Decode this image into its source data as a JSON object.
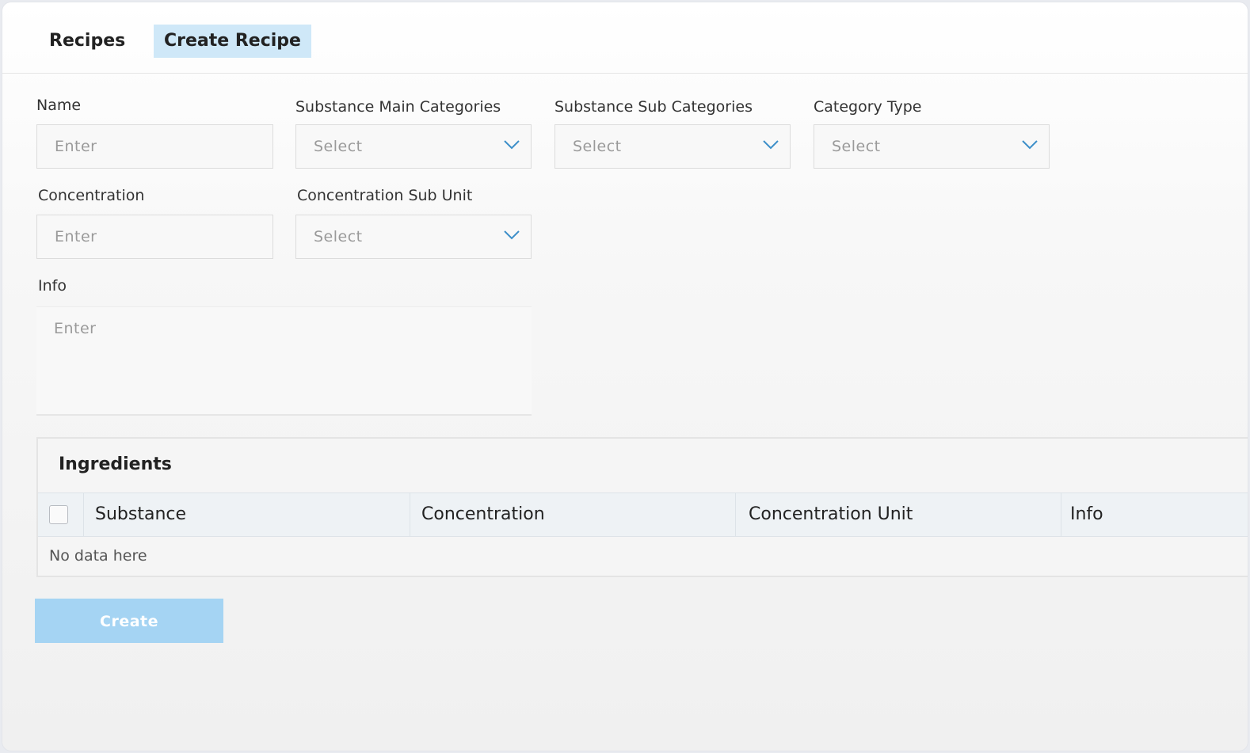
{
  "tabs": [
    {
      "label": "Recipes"
    },
    {
      "label": "Create Recipe"
    }
  ],
  "form": {
    "name": {
      "label": "Name",
      "placeholder": "Enter"
    },
    "main_categories": {
      "label": "Substance Main Categories",
      "value": "Select"
    },
    "sub_categories": {
      "label": "Substance Sub Categories",
      "value": "Select"
    },
    "category_type": {
      "label": "Category Type",
      "value": "Select"
    },
    "concentration": {
      "label": "Concentration",
      "placeholder": "Enter"
    },
    "concentration_sub_unit": {
      "label": "Concentration Sub Unit",
      "value": "Select"
    },
    "info": {
      "label": "Info",
      "placeholder": "Enter"
    }
  },
  "ingredients": {
    "title": "Ingredients",
    "columns": [
      "Substance",
      "Concentration",
      "Concentration Unit",
      "Info"
    ],
    "empty_text": "No data here"
  },
  "actions": {
    "create_label": "Create"
  },
  "icons": {
    "dropdown": "chevron-down-icon",
    "checkbox": "checkbox-icon"
  },
  "colors": {
    "active_tab": "#cfe8f8",
    "create_button": "#a5d4f3",
    "chevron": "#3d8fc9"
  }
}
